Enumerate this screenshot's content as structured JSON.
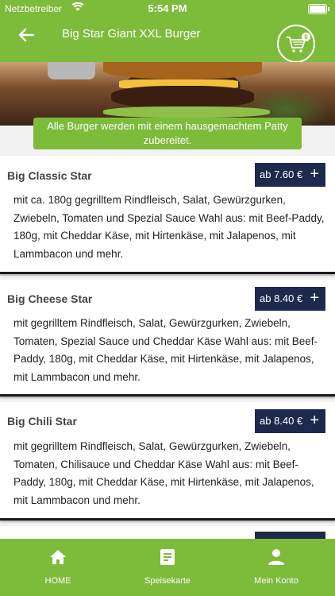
{
  "status_bar": {
    "carrier": "Netzbetreiber",
    "time": "5:54 PM"
  },
  "header": {
    "title": "Big Star Giant XXL Burger",
    "cart_count": "0"
  },
  "banner": "Alle Burger werden mit einem hausgemachtem Patty zubereitet.",
  "products": [
    {
      "name": "Big Classic Star",
      "price": "ab 7.60 €",
      "plus": "+",
      "description": "mit ca. 180g gegrilltem Rindfleisch, Salat, Gewürzgurken, Zwiebeln, Tomaten und Spezial Sauce Wahl aus: mit Beef-Paddy, 180g, mit Cheddar Käse, mit Hirtenkäse, mit Jalapenos, mit Lammbacon und mehr."
    },
    {
      "name": "Big Cheese Star",
      "price": "ab 8.40 €",
      "plus": "+",
      "description": "mit gegrilltem Rindfleisch, Salat, Gewürzgurken, Zwiebeln, Tomaten, Spezial Sauce und Cheddar Käse Wahl aus: mit Beef-Paddy, 180g, mit Cheddar Käse, mit Hirtenkäse, mit Jalapenos, mit Lammbacon und mehr."
    },
    {
      "name": "Big Chili Star",
      "price": "ab 8.40 €",
      "plus": "+",
      "description": "mit gegrilltem Rindfleisch, Salat, Gewürzgurken, Zwiebeln, Tomaten, Chilisauce und Cheddar Käse Wahl aus: mit Beef-Paddy, 180g, mit Cheddar Käse, mit Hirtenkäse, mit Jalapenos, mit Lammbacon und mehr."
    }
  ],
  "tabs": [
    {
      "label": "HOME",
      "icon": "home-icon"
    },
    {
      "label": "Speisekarte",
      "icon": "menu-icon"
    },
    {
      "label": "Mein Konto",
      "icon": "account-icon"
    }
  ],
  "colors": {
    "primary": "#7dbb3a",
    "price_bg": "#1d2a4e"
  }
}
